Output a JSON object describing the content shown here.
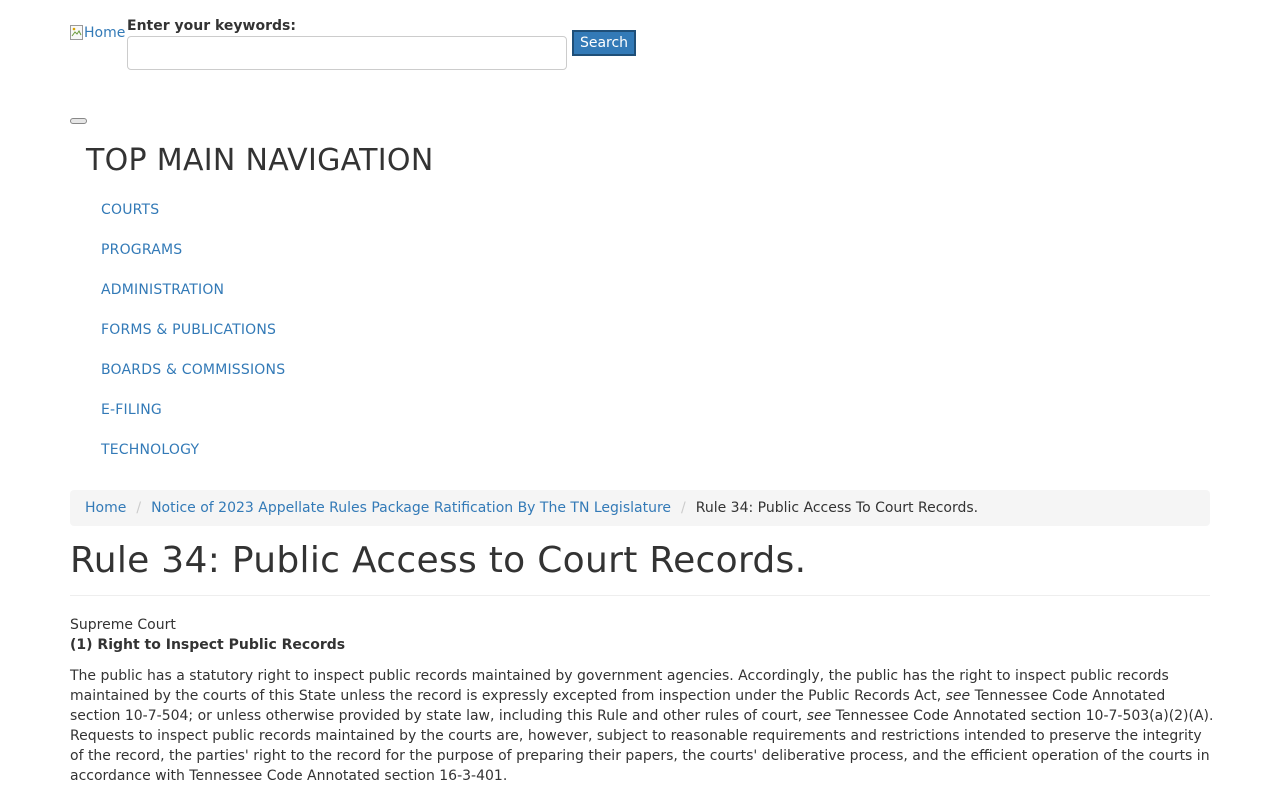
{
  "header": {
    "home_alt": "Home",
    "search_label": "Enter your keywords:",
    "search_value": "",
    "search_button": "Search"
  },
  "nav": {
    "title": "TOP MAIN NAVIGATION",
    "items": [
      {
        "label": "COURTS"
      },
      {
        "label": "PROGRAMS"
      },
      {
        "label": "ADMINISTRATION"
      },
      {
        "label": "FORMS & PUBLICATIONS"
      },
      {
        "label": "BOARDS & COMMISSIONS"
      },
      {
        "label": "E-FILING"
      },
      {
        "label": "TECHNOLOGY"
      }
    ]
  },
  "breadcrumb": {
    "items": [
      {
        "label": "Home"
      },
      {
        "label": "Notice of 2023 Appellate Rules Package Ratification By The TN Legislature"
      }
    ],
    "separator": "/",
    "current": "Rule 34: Public Access To Court Records."
  },
  "page": {
    "title": "Rule 34: Public Access to Court Records.",
    "court": "Supreme Court",
    "section_heading": "(1) Right to Inspect Public Records",
    "paragraph": {
      "part1": "The public has a statutory right to inspect public records maintained by government agencies. Accordingly, the public has the right to inspect public records maintained by the courts of this State unless the record is expressly excepted from inspection under the Public Records Act, ",
      "see1": "see",
      "part2": " Tennessee Code Annotated section 10-7-504; or unless otherwise provided by state law, including this Rule and other rules of court, ",
      "see2": "see",
      "part3": " Tennessee Code Annotated section 10-7-503(a)(2)(A). Requests to inspect public records maintained by the courts are, however, subject to reasonable requirements and restrictions intended to preserve the integrity of the record, the parties' right to the record for the purpose of preparing their papers, the courts' deliberative process, and the efficient operation of the courts in accordance with Tennessee Code Annotated section 16-3-401."
    }
  },
  "colors": {
    "link": "#337ab7",
    "text": "#333333",
    "breadcrumb_bg": "#f5f5f5",
    "button_bg": "#337ab7"
  }
}
